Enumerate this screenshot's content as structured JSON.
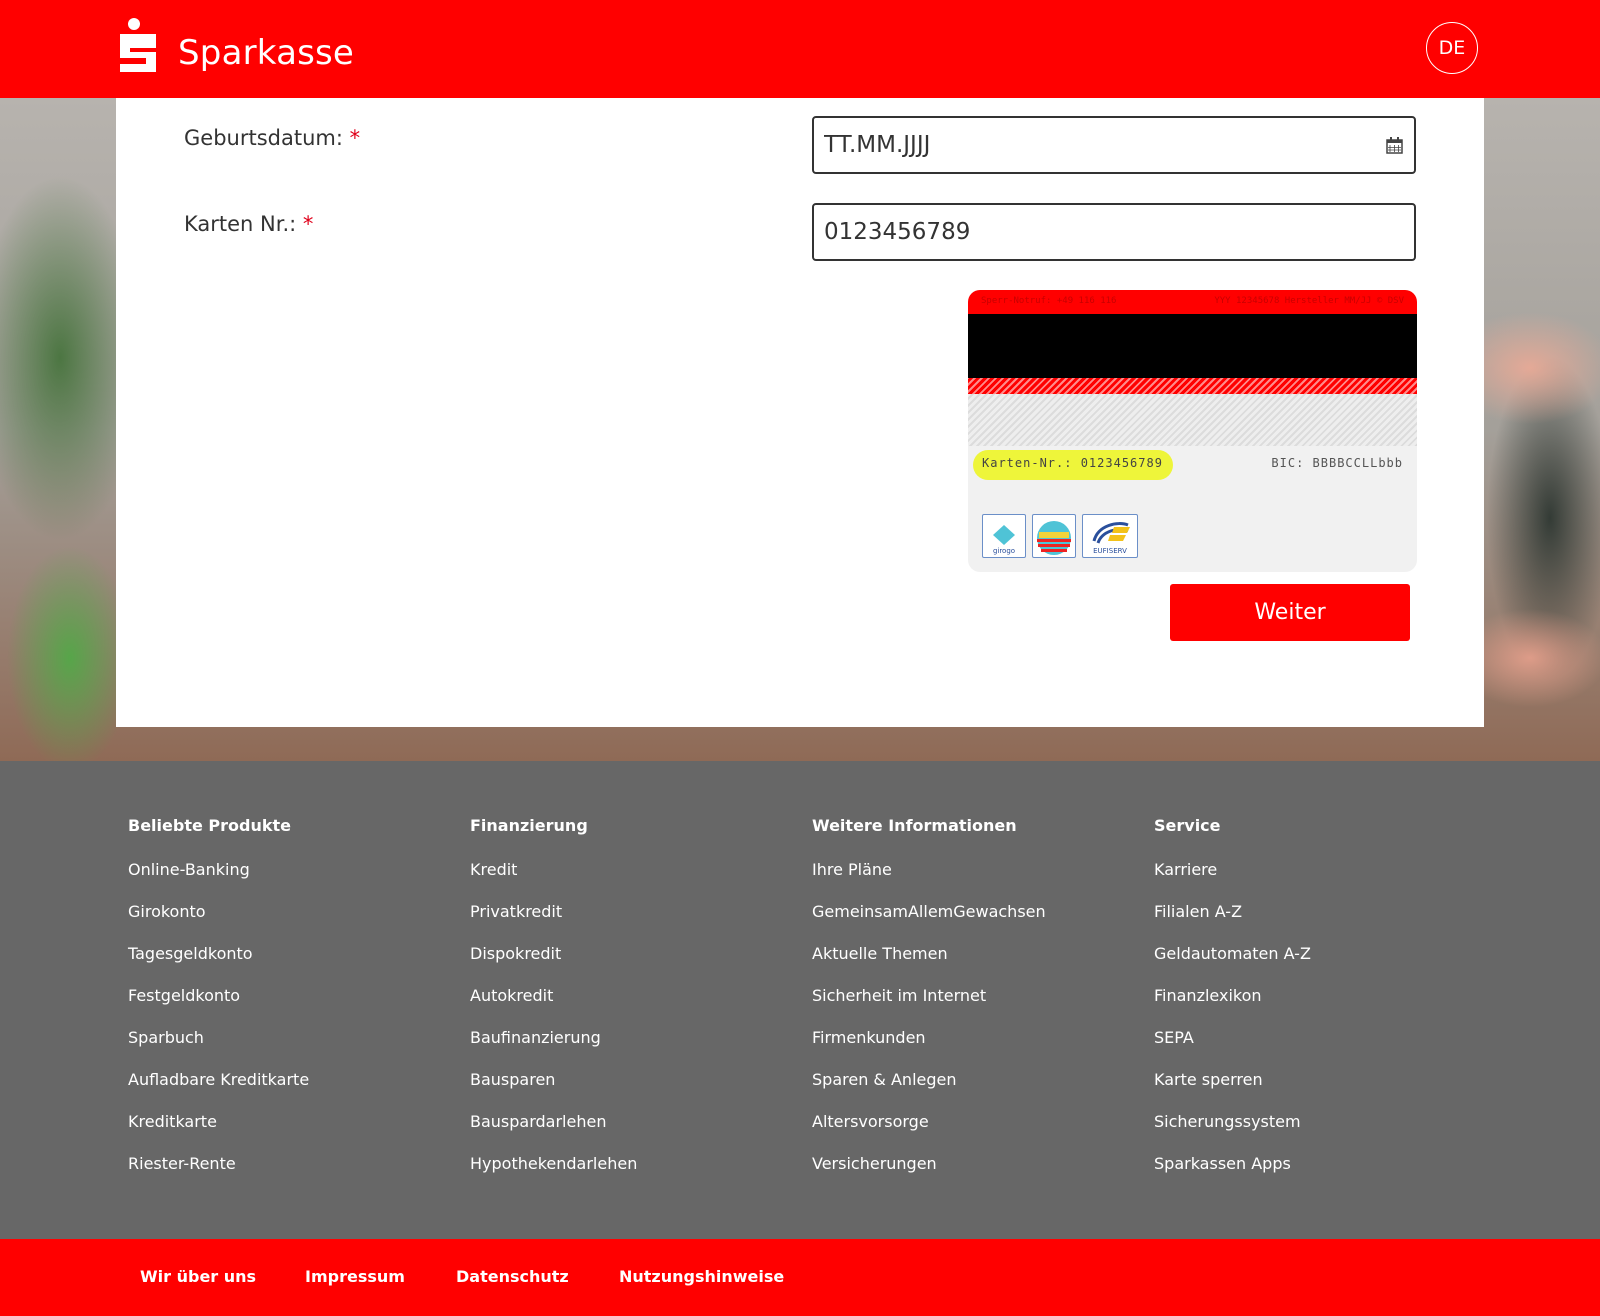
{
  "header": {
    "brand": "Sparkasse",
    "lang": "DE",
    "accent_color": "#ff0000"
  },
  "form": {
    "birthdate_label": "Geburtsdatum:",
    "birthdate_placeholder": "TT.MM.JJJJ",
    "card_label": "Karten Nr.:",
    "card_value": "0123456789",
    "required_mark": "*",
    "submit_label": "Weiter"
  },
  "card_image": {
    "top_left": "Sperr-Notruf: +49 116 116",
    "top_right": "YYY 12345678 Hersteller MM/JJ © DSV",
    "card_number": "Karten-Nr.: 0123456789",
    "bic": "BIC: BBBBCCLLbbb",
    "logos": [
      "girogo",
      "GeldKarte",
      "EUFISERV"
    ]
  },
  "footer": {
    "columns": [
      {
        "title": "Beliebte Produkte",
        "links": [
          "Online-Banking",
          "Girokonto",
          "Tagesgeldkonto",
          "Festgeldkonto",
          "Sparbuch",
          "Aufladbare Kreditkarte",
          "Kreditkarte",
          "Riester-Rente"
        ]
      },
      {
        "title": "Finanzierung",
        "links": [
          "Kredit",
          "Privatkredit",
          "Dispokredit",
          "Autokredit",
          "Baufinanzierung",
          "Bausparen",
          "Bauspardarlehen",
          "Hypothekendarlehen"
        ]
      },
      {
        "title": "Weitere Informationen",
        "links": [
          "Ihre Pläne",
          "GemeinsamAllemGewachsen",
          "Aktuelle Themen",
          "Sicherheit im Internet",
          "Firmenkunden",
          "Sparen & Anlegen",
          "Altersvorsorge",
          "Versicherungen"
        ]
      },
      {
        "title": "Service",
        "links": [
          "Karriere",
          "Filialen A-Z",
          "Geldautomaten A-Z",
          "Finanzlexikon",
          "SEPA",
          "Karte sperren",
          "Sicherungssystem",
          "Sparkassen Apps"
        ]
      }
    ],
    "bottom_links": [
      "Wir über uns",
      "Impressum",
      "Datenschutz",
      "Nutzungshinweise"
    ]
  }
}
